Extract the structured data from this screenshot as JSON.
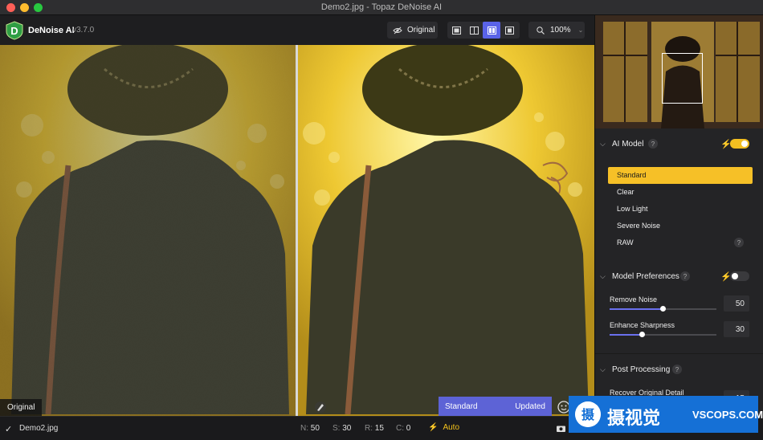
{
  "window": {
    "title": "Demo2.jpg - Topaz DeNoise AI"
  },
  "toolbar": {
    "app_name": "DeNoise AI",
    "app_version": "v3.7.0",
    "original_label": "Original",
    "zoom_level": "100%",
    "active_view": "side-by-side"
  },
  "canvas": {
    "left_label": "Original",
    "status": {
      "model": "Standard",
      "state": "Updated",
      "progress": 1.0
    }
  },
  "bottombar": {
    "filename": "Demo2.jpg",
    "stats": [
      {
        "key": "N:",
        "value": "50"
      },
      {
        "key": "S:",
        "value": "30"
      },
      {
        "key": "R:",
        "value": "15"
      },
      {
        "key": "C:",
        "value": "0"
      }
    ],
    "auto_label": "Auto"
  },
  "sidebar": {
    "ai_model": {
      "title": "AI Model",
      "auto_enabled": true,
      "models": [
        "Standard",
        "Clear",
        "Low Light",
        "Severe Noise",
        "RAW"
      ],
      "selected": "Standard"
    },
    "model_preferences": {
      "title": "Model Preferences",
      "enabled": false,
      "sliders": [
        {
          "label": "Remove Noise",
          "value": "50",
          "fraction": 0.5
        },
        {
          "label": "Enhance Sharpness",
          "value": "30",
          "fraction": 0.3
        }
      ]
    },
    "post_processing": {
      "title": "Post Processing",
      "sliders": [
        {
          "label": "Recover Original Detail",
          "value": "15"
        }
      ]
    }
  },
  "watermark": {
    "cn_text": "摄视觉",
    "en_text": "VSCOPS.COM"
  },
  "colors": {
    "accent": "#5a63e8",
    "highlight": "#f6c027",
    "progress": "#27c24c"
  }
}
